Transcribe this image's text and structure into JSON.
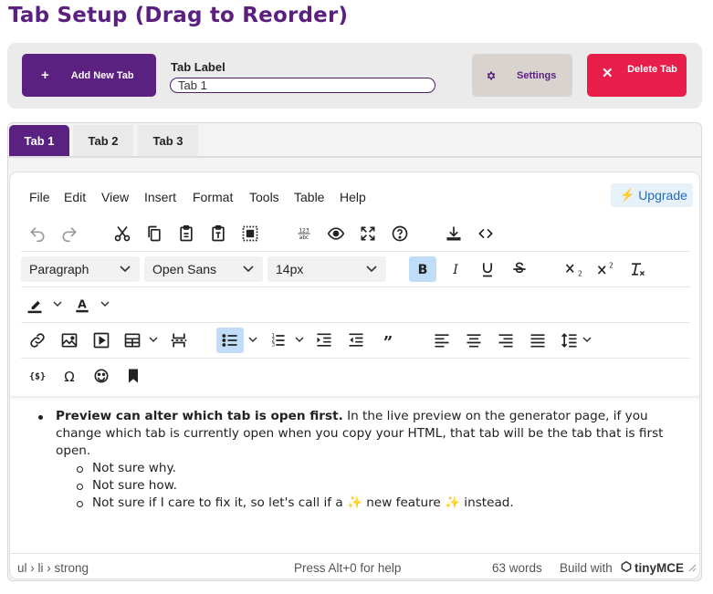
{
  "page": {
    "title": "Tab Setup (Drag to Reorder)"
  },
  "controls": {
    "add_tab_icon": "+",
    "add_tab_label": "Add New Tab",
    "tab_label_title": "Tab Label",
    "tab_label_value": "Tab 1",
    "settings_label": "Settings",
    "delete_icon": "✕",
    "delete_label": "Delete Tab"
  },
  "tabs": [
    {
      "label": "Tab 1",
      "active": true
    },
    {
      "label": "Tab 2",
      "active": false
    },
    {
      "label": "Tab 3",
      "active": false
    }
  ],
  "editor": {
    "menu": [
      "File",
      "Edit",
      "View",
      "Insert",
      "Format",
      "Tools",
      "Table",
      "Help"
    ],
    "upgrade_label": "Upgrade",
    "block_format": "Paragraph",
    "font_family": "Open Sans",
    "font_size": "14px",
    "content": {
      "bold_lead": "Preview can alter which tab is open first.",
      "lead_text": " In the live preview on the generator page, if you change which tab is currently open when you copy your HTML, that tab will be the tab that is first open.",
      "sub_items": [
        "Not sure why.",
        "Not sure how.",
        "Not sure if I care to fix it, so let's call if a ✨ new feature ✨ instead."
      ]
    },
    "status": {
      "path": "ul › li › strong",
      "shortcut_hint": "Press Alt+0 for help",
      "word_count": "63 words",
      "build_with": "Build with",
      "brand": "tinyMCE"
    }
  },
  "colors": {
    "brand_purple": "#5b2180",
    "delete_red": "#e81e4a",
    "settings_bg": "#d8d3cf",
    "active_toggle": "#bfdcf9"
  }
}
